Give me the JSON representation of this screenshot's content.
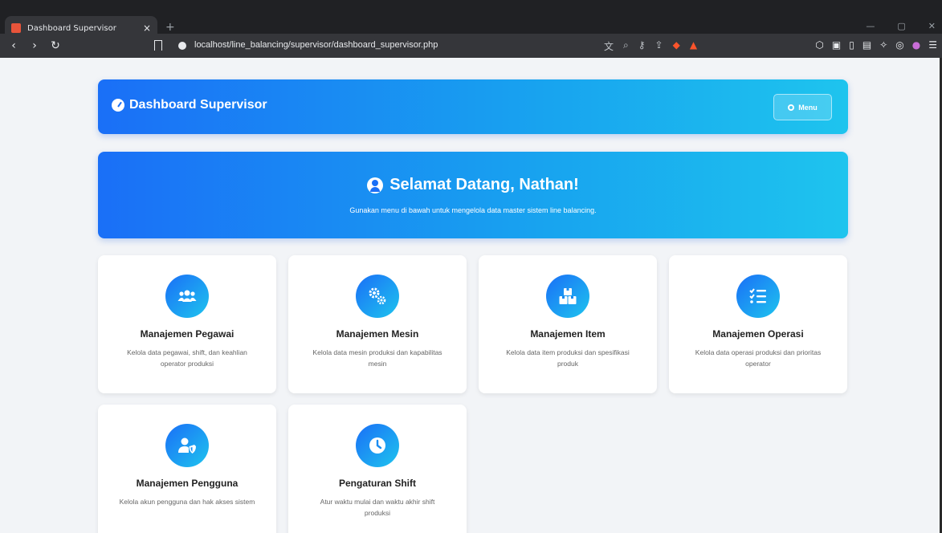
{
  "browser": {
    "tab_title": "Dashboard Supervisor",
    "tab_close": "×",
    "new_tab": "+",
    "url": "localhost/line_balancing/supervisor/dashboard_supervisor.php"
  },
  "header": {
    "title": "Dashboard Supervisor",
    "menu_label": "Menu"
  },
  "welcome": {
    "title": "Selamat Datang, Nathan!",
    "subtitle": "Gunakan menu di bawah untuk mengelola data master sistem line balancing."
  },
  "cards": [
    {
      "icon": "users-icon",
      "title": "Manajemen Pegawai",
      "desc": "Kelola data pegawai, shift, dan keahlian operator produksi"
    },
    {
      "icon": "gears-icon",
      "title": "Manajemen Mesin",
      "desc": "Kelola data mesin produksi dan kapabilitas mesin"
    },
    {
      "icon": "boxes-icon",
      "title": "Manajemen Item",
      "desc": "Kelola data item produksi dan spesifikasi produk"
    },
    {
      "icon": "list-check-icon",
      "title": "Manajemen Operasi",
      "desc": "Kelola data operasi produksi dan prioritas operator"
    },
    {
      "icon": "user-shield-icon",
      "title": "Manajemen Pengguna",
      "desc": "Kelola akun pengguna dan hak akses sistem"
    },
    {
      "icon": "clock-icon",
      "title": "Pengaturan Shift",
      "desc": "Atur waktu mulai dan waktu akhir shift produksi"
    }
  ],
  "colors": {
    "accent_start": "#1a6ff7",
    "accent_end": "#1ec4ee",
    "page_bg": "#f2f4f7"
  }
}
